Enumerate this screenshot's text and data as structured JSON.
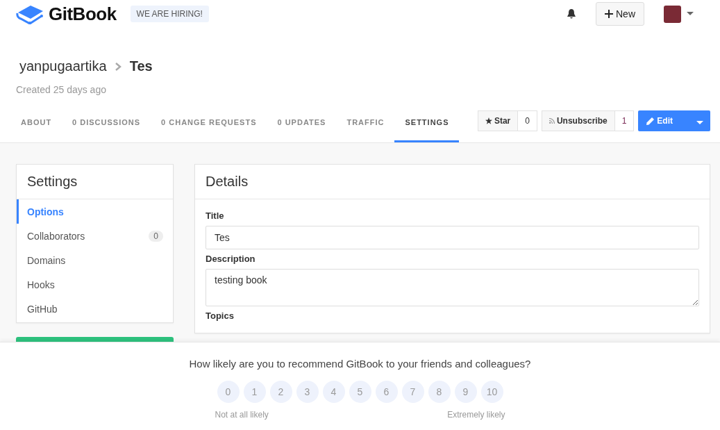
{
  "header": {
    "logo": "GitBook",
    "hiring_badge": "WE ARE HIRING!",
    "new_button": "New"
  },
  "breadcrumb": {
    "owner": "yanpugaartika",
    "book": "Tes"
  },
  "created": "Created 25 days ago",
  "tabs": [
    {
      "label": "ABOUT",
      "selected": false
    },
    {
      "label": "0 DISCUSSIONS",
      "selected": false
    },
    {
      "label": "0 CHANGE REQUESTS",
      "selected": false
    },
    {
      "label": "0 UPDATES",
      "selected": false
    },
    {
      "label": "TRAFFIC",
      "selected": false
    },
    {
      "label": "SETTINGS",
      "selected": true
    }
  ],
  "actions": {
    "star": "Star",
    "star_count": "0",
    "subscribe": "Unsubscribe",
    "subscribe_count": "1",
    "edit": "Edit"
  },
  "sidebar": {
    "title": "Settings",
    "items": [
      {
        "label": "Options",
        "selected": true
      },
      {
        "label": "Collaborators",
        "selected": false,
        "count": "0"
      },
      {
        "label": "Domains",
        "selected": false
      },
      {
        "label": "Hooks",
        "selected": false
      },
      {
        "label": "GitHub",
        "selected": false
      }
    ]
  },
  "details": {
    "title": "Details",
    "fields": [
      {
        "label": "Title",
        "kind": "input",
        "value": "Tes"
      },
      {
        "label": "Description",
        "kind": "textarea",
        "value": "testing book"
      },
      {
        "label": "Topics",
        "kind": "label"
      }
    ]
  },
  "survey": {
    "question": "How likely are you to recommend GitBook to your friends and colleagues?",
    "scores": [
      "0",
      "1",
      "2",
      "3",
      "4",
      "5",
      "6",
      "7",
      "8",
      "9",
      "10"
    ],
    "low_label": "Not at all likely",
    "high_label": "Extremely likely"
  }
}
